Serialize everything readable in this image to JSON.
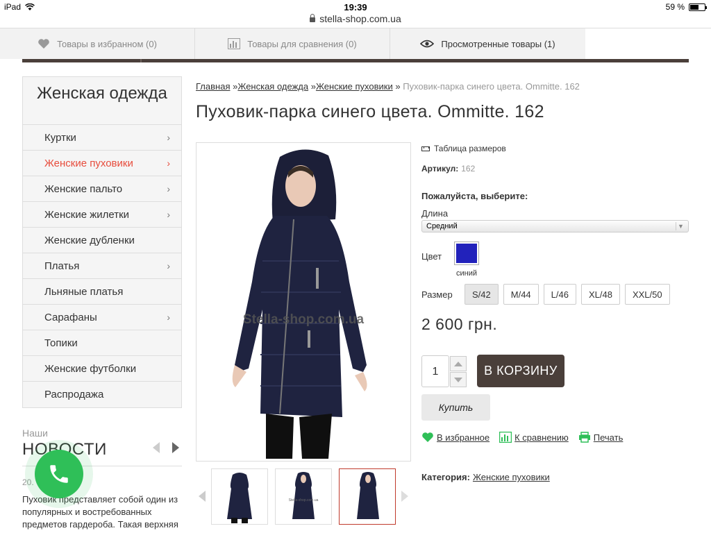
{
  "statusbar": {
    "device": "iPad",
    "time": "19:39",
    "battery": "59 %"
  },
  "browser": {
    "url": "stella-shop.com.ua"
  },
  "toolbar": {
    "favorites": "Товары в избранном (0)",
    "compare": "Товары для сравнения (0)",
    "viewed": "Просмотренные товары (1)"
  },
  "sidebar": {
    "title": "Женская одежда",
    "items": [
      {
        "label": "Куртки",
        "chevron": true,
        "active": false
      },
      {
        "label": "Женские пуховики",
        "chevron": true,
        "active": true
      },
      {
        "label": "Женские пальто",
        "chevron": true,
        "active": false
      },
      {
        "label": "Женские жилетки",
        "chevron": true,
        "active": false
      },
      {
        "label": "Женские дубленки",
        "chevron": false,
        "active": false
      },
      {
        "label": "Платья",
        "chevron": true,
        "active": false
      },
      {
        "label": "Льняные платья",
        "chevron": false,
        "active": false
      },
      {
        "label": "Сарафаны",
        "chevron": true,
        "active": false
      },
      {
        "label": "Топики",
        "chevron": false,
        "active": false
      },
      {
        "label": "Женские футболки",
        "chevron": false,
        "active": false
      },
      {
        "label": "Распродажа",
        "chevron": false,
        "active": false
      }
    ]
  },
  "news": {
    "small": "Наши",
    "title": "НОВОСТИ",
    "date": "20.",
    "text": "Пуховик представляет собой один из популярных и востребованных предметов гардероба. Такая верхняя одежда об"
  },
  "breadcrumb": {
    "home": "Главная",
    "cat1": "Женская одежда",
    "cat2": "Женские пуховики",
    "current": "Пуховик-парка синего цвета. Ommitte. 162",
    "sep": "»"
  },
  "product": {
    "title": "Пуховик-парка синего цвета. Ommitte. 162",
    "watermark": "Stella-shop.com.ua",
    "size_table": "Таблица размеров",
    "sku_label": "Артикул:",
    "sku_value": "162",
    "choose": "Пожалуйста, выберите:",
    "length_label": "Длина",
    "length_value": "Средний",
    "color_label": "Цвет",
    "color_name": "синий",
    "color_hex": "#2222bb",
    "size_label": "Размер",
    "sizes": [
      "S/42",
      "M/44",
      "L/46",
      "XL/48",
      "XXL/50"
    ],
    "size_selected": "S/42",
    "price": "2 600 грн.",
    "qty": "1",
    "cart": "В КОРЗИНУ",
    "buy": "Купить",
    "fav": "В избранное",
    "compare": "К сравнению",
    "print": "Печать",
    "category_label": "Категория:",
    "category_value": "Женские пуховики"
  },
  "colors": {
    "accent_dark": "#4a3f3a",
    "active_red": "#e74c3c",
    "green": "#2fbf58"
  }
}
